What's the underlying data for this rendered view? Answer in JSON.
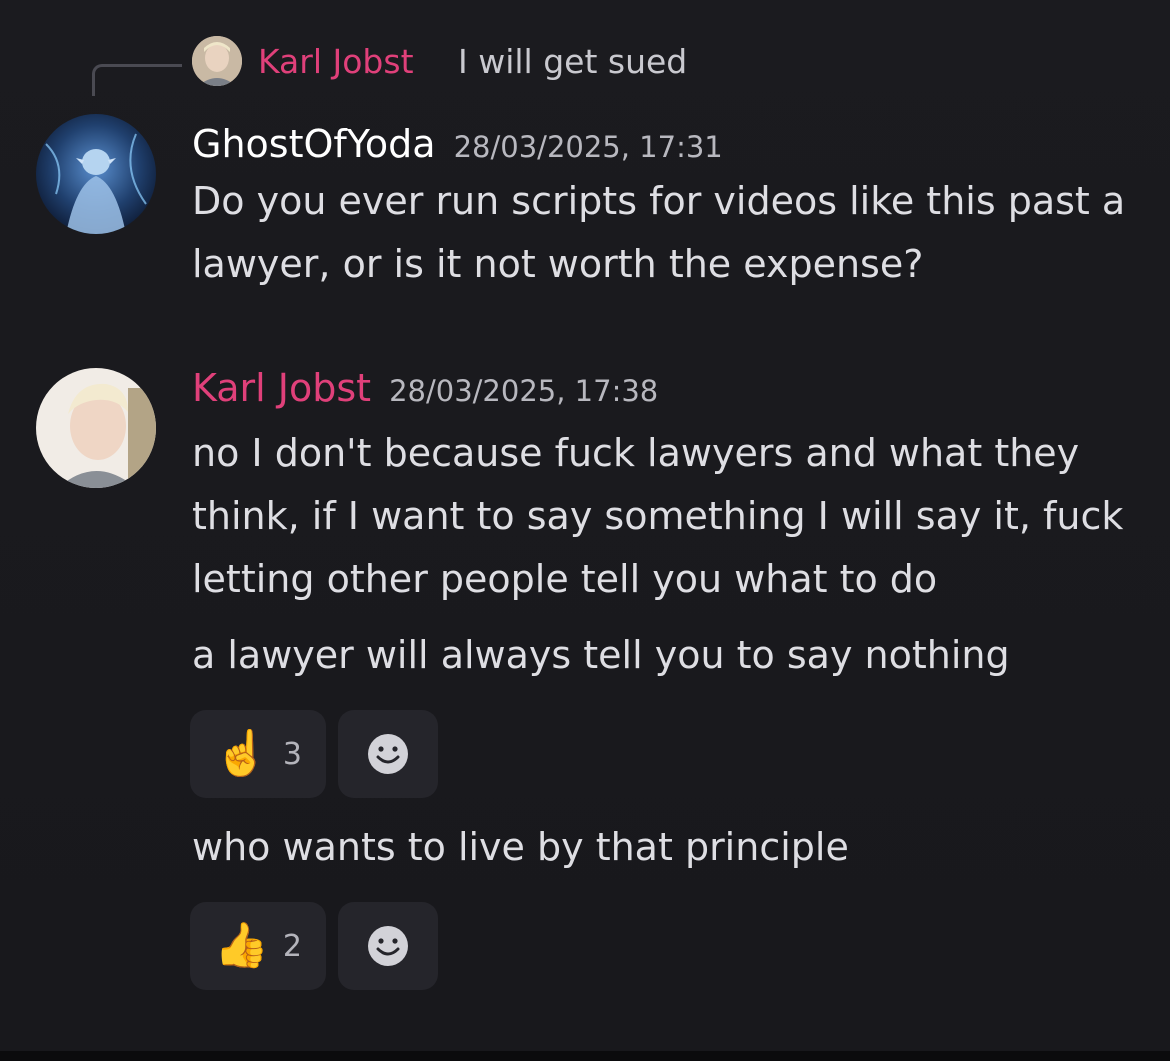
{
  "reply": {
    "author": "Karl Jobst",
    "text": "I will get sued"
  },
  "messages": [
    {
      "author": "GhostOfYoda",
      "timestamp": "28/03/2025, 17:31",
      "paragraphs": [
        "Do you ever run scripts for videos like this past a lawyer, or is it not worth the expense?"
      ]
    },
    {
      "author": "Karl Jobst",
      "timestamp": "28/03/2025, 17:38",
      "paragraphs": [
        "no I don't because fuck lawyers and what they think, if I want to say something I will say it, fuck letting other people tell you what to do",
        "a lawyer will always tell you to say nothing",
        "who wants to live by that principle"
      ]
    }
  ],
  "reactions": [
    {
      "emoji": "☝️",
      "icon": "index-pointing-up-icon",
      "count": "3"
    },
    {
      "emoji": "👍",
      "icon": "thumbs-up-icon",
      "count": "2"
    }
  ],
  "colors": {
    "background": "#1b1b1f",
    "accent_author": "#e0407a",
    "reaction_bg": "#25252b"
  }
}
